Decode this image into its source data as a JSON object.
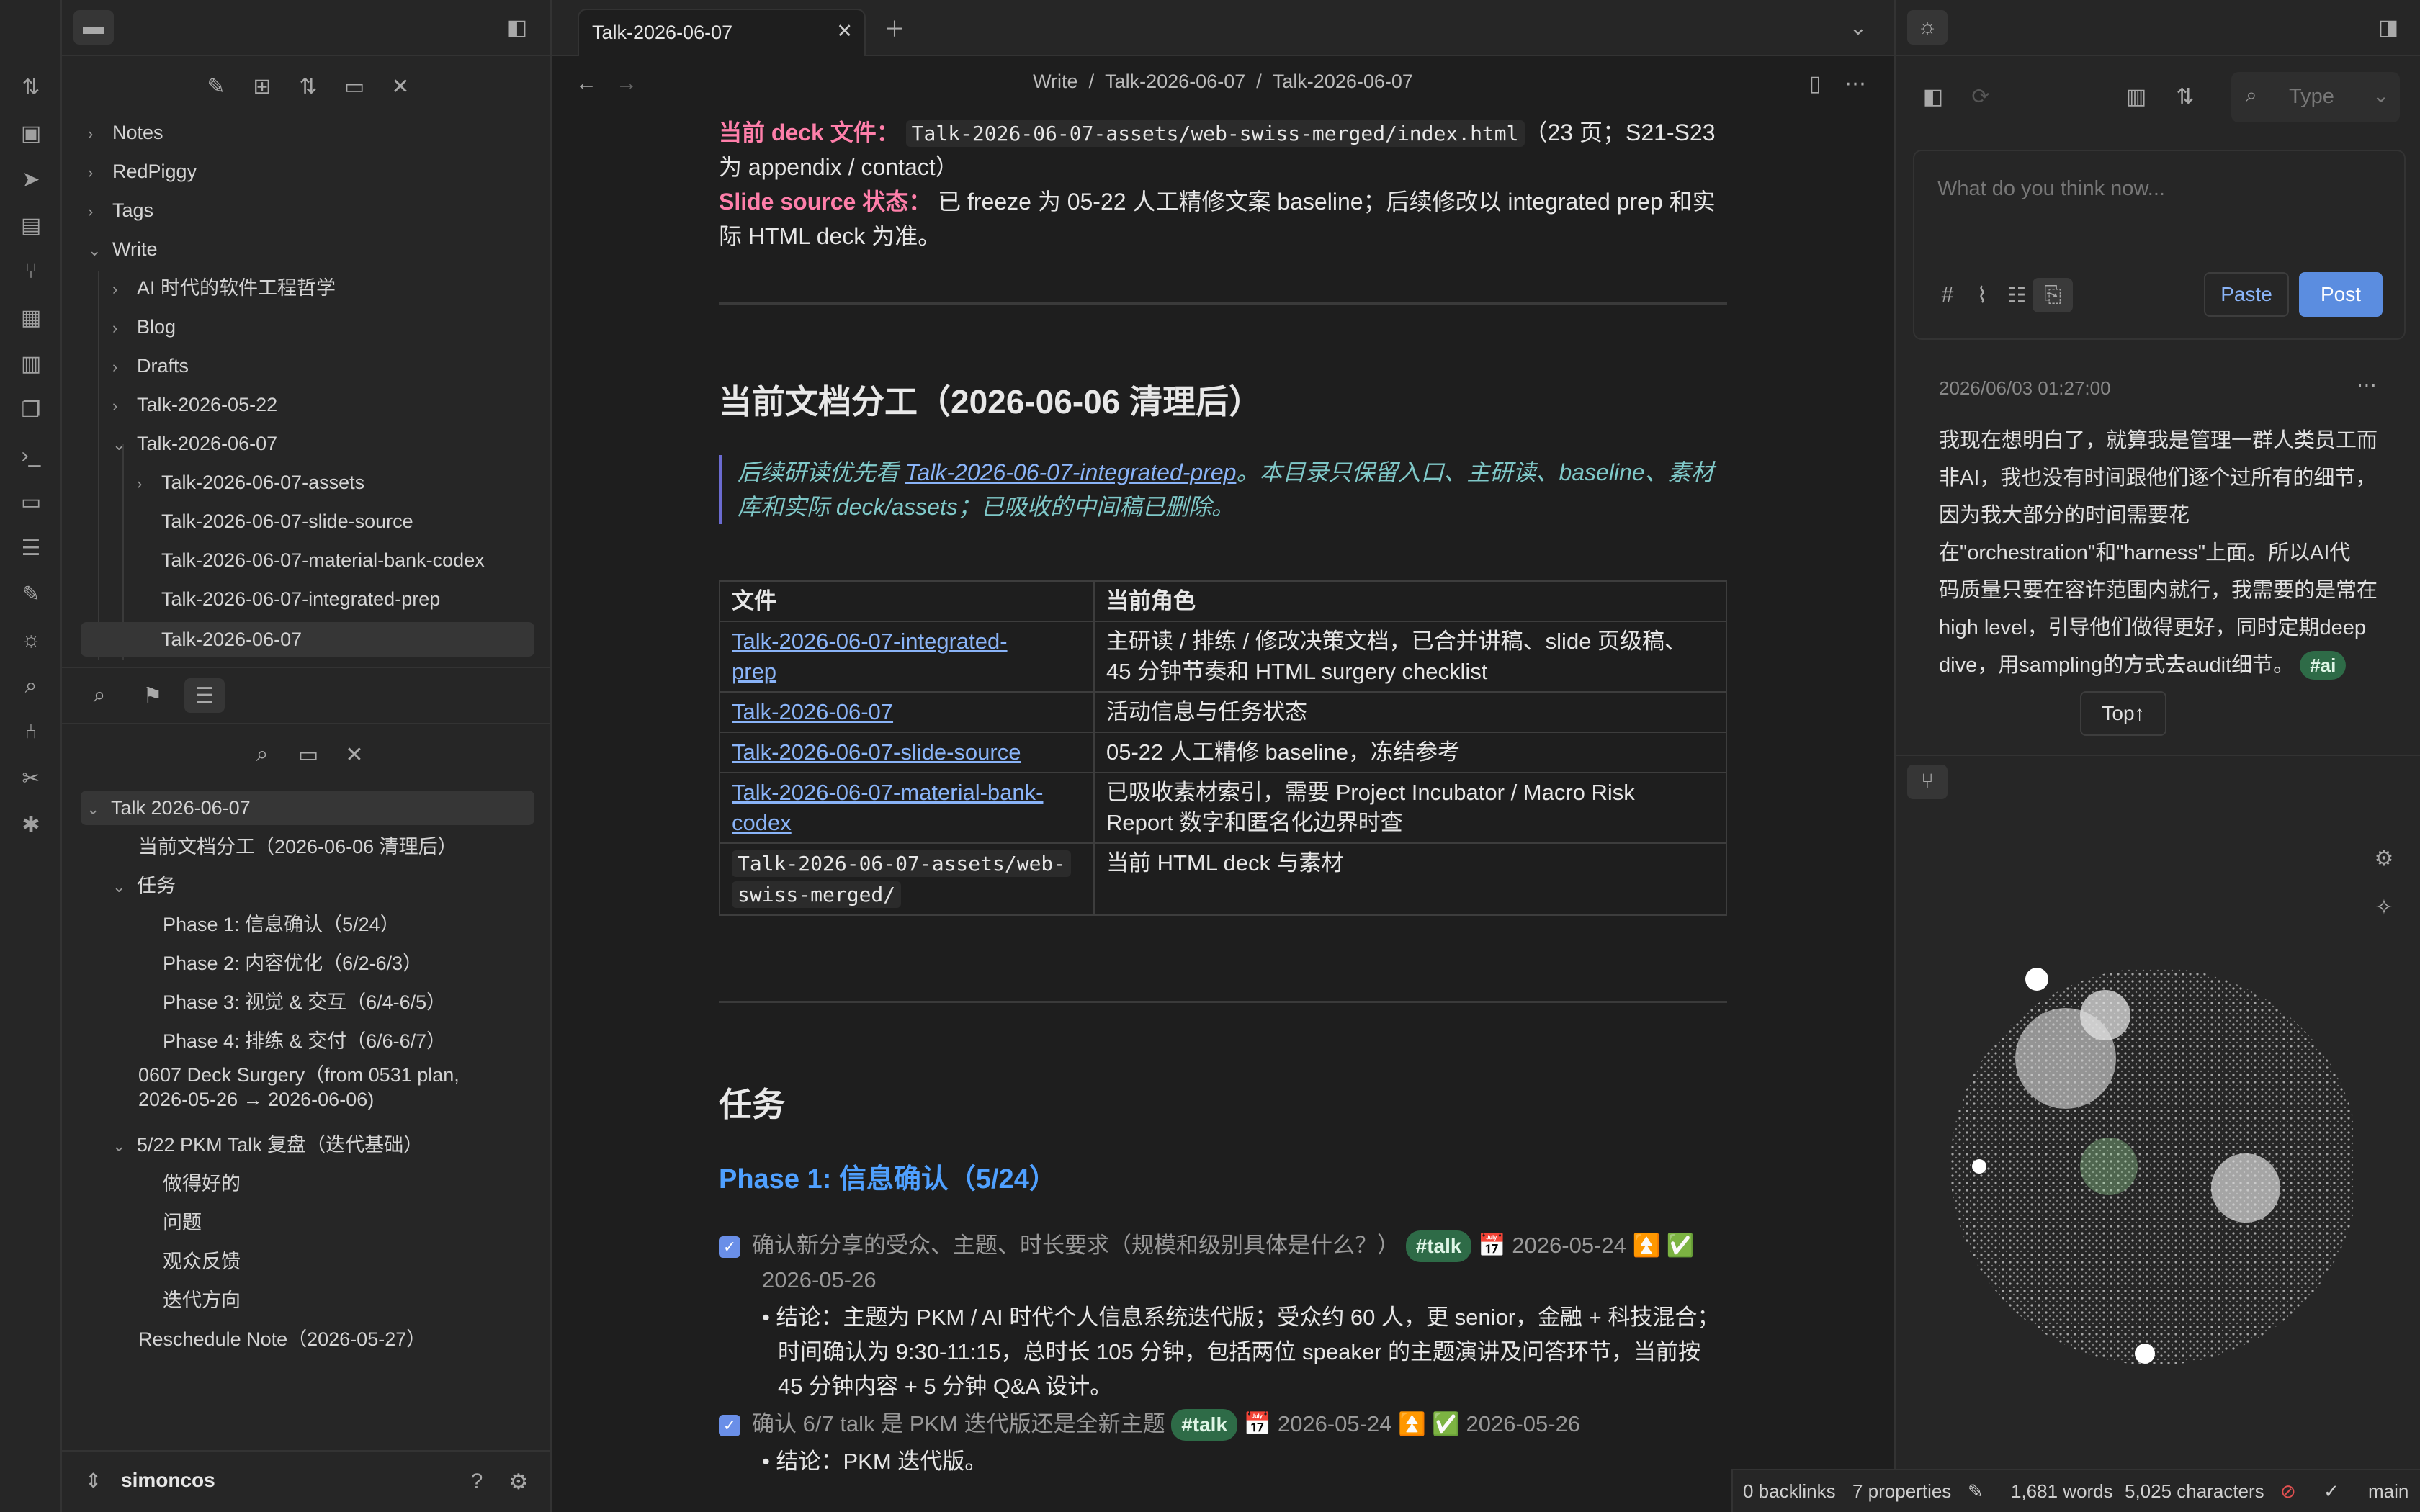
{
  "left_panel": {
    "tree": [
      {
        "label": "Notes"
      },
      {
        "label": "RedPiggy"
      },
      {
        "label": "Tags"
      },
      {
        "label": "Write"
      },
      {
        "label": "AI 时代的软件工程哲学"
      },
      {
        "label": "Blog"
      },
      {
        "label": "Drafts"
      },
      {
        "label": "Talk-2026-05-22"
      },
      {
        "label": "Talk-2026-06-07"
      },
      {
        "label": "Talk-2026-06-07-assets"
      },
      {
        "label": "Talk-2026-06-07-slide-source"
      },
      {
        "label": "Talk-2026-06-07-material-bank-codex"
      },
      {
        "label": "Talk-2026-06-07-integrated-prep"
      },
      {
        "label": "Talk-2026-06-07"
      }
    ],
    "outline": [
      {
        "label": "Talk 2026-06-07"
      },
      {
        "label": "当前文档分工（2026-06-06 清理后）"
      },
      {
        "label": "任务"
      },
      {
        "label": "Phase 1: 信息确认（5/24）"
      },
      {
        "label": "Phase 2: 内容优化（6/2-6/3）"
      },
      {
        "label": "Phase 3: 视觉 & 交互（6/4-6/5）"
      },
      {
        "label": "Phase 4: 排练 & 交付（6/6-6/7）"
      },
      {
        "label": "0607 Deck Surgery（from 0531 plan,"
      },
      {
        "label": "2026-05-26 → 2026-06-06)"
      },
      {
        "label": "5/22 PKM Talk 复盘（迭代基础）"
      },
      {
        "label": "做得好的"
      },
      {
        "label": "问题"
      },
      {
        "label": "观众反馈"
      },
      {
        "label": "迭代方向"
      },
      {
        "label": "Reschedule Note（2026-05-27）"
      }
    ],
    "user": "simoncos"
  },
  "editor": {
    "tab_title": "Talk-2026-06-07",
    "breadcrumb": [
      "Write",
      "/",
      "Talk-2026-06-07",
      "/",
      "Talk-2026-06-07"
    ],
    "deck_label": "当前 deck 文件：",
    "deck_path": "Talk-2026-06-07-assets/web-swiss-merged/index.html",
    "deck_rest1": "（23 页；S21-S23",
    "deck_rest2": "为 appendix / contact）",
    "slide_label": "Slide source 状态：",
    "slide_text1": "已 freeze 为 05-22 人工精修文案 baseline；后续修改以 integrated prep 和实",
    "slide_text2": "际 HTML deck 为准。",
    "h_division": "当前文档分工（2026-06-06 清理后）",
    "quote_pre": "后续研读优先看 ",
    "quote_link": "Talk-2026-06-07-integrated-prep",
    "quote_post1": "。本目录只保留入口、主研读、baseline、素材",
    "quote_post2": "库和实际 deck/assets；已吸收的中间稿已删除。",
    "table_head": [
      "文件",
      "当前角色"
    ],
    "rows": [
      {
        "f1": "Talk-2026-06-07-integrated-",
        "f2": "prep",
        "r1": "主研读 / 排练 / 修改决策文档，已合并讲稿、slide 页级稿、",
        "r2": "45 分钟节奏和 HTML surgery checklist"
      },
      {
        "f1": "Talk-2026-06-07",
        "f2": "",
        "r1": "活动信息与任务状态",
        "r2": ""
      },
      {
        "f1": "Talk-2026-06-07-slide-source",
        "f2": "",
        "r1": "05-22 人工精修 baseline，冻结参考",
        "r2": ""
      },
      {
        "f1": "Talk-2026-06-07-material-bank-",
        "f2": "codex",
        "r1": "已吸收素材索引，需要 Project Incubator / Macro Risk",
        "r2": "Report 数字和匿名化边界时查"
      },
      {
        "f1": "Talk-2026-06-07-assets/web-",
        "f2": "swiss-merged/",
        "r1": "当前 HTML deck 与素材",
        "r2": ""
      }
    ],
    "h_tasks": "任务",
    "h_phase1": "Phase 1: 信息确认（5/24）",
    "task1_text": "确认新分享的受众、主题、时长要求（规模和级别具体是什么？）",
    "task1_tag": "#talk",
    "task1_meta": "📅 2026-05-24 ⏫ ✅",
    "task1_date2": "2026-05-26",
    "task1_sub1": "结论：主题为 PKM / AI 时代个人信息系统迭代版；受众约 60 人，更 senior，金融 + 科技混合；",
    "task1_sub2": "时间确认为 9:30-11:15，总时长 105 分钟，包括两位 speaker 的主题演讲及问答环节，当前按",
    "task1_sub3": "45 分钟内容 + 5 分钟 Q&A 设计。",
    "task2_text": "确认 6/7 talk 是 PKM 迭代版还是全新主题",
    "task2_tag": "#talk",
    "task2_meta": "📅 2026-05-24 ⏫ ✅ 2026-05-26",
    "task2_sub": "结论：PKM 迭代版。"
  },
  "right_panel": {
    "search_placeholder": "Type",
    "input_placeholder": "What do you think now...",
    "paste_label": "Paste",
    "post_label": "Post",
    "memo_time": "2026/06/03 01:27:00",
    "memo_lines": [
      "我现在想明白了，就算我是管理一群人类员工而",
      "非AI，我也没有时间跟他们逐个过所有的细节，",
      "因为我大部分的时间需要花",
      "在\"orchestration\"和\"harness\"上面。所以AI代",
      "码质量只要在容许范围内就行，我需要的是常在",
      "high level，引导他们做得更好，同时定期deep",
      "dive，用sampling的方式去audit细节。"
    ],
    "memo_tag": "#ai",
    "top_label": "Top↑"
  },
  "status_bar": {
    "backlinks": "0 backlinks",
    "properties": "7 properties",
    "words": "1,681 words",
    "characters": "5,025 characters",
    "branch": "main"
  }
}
